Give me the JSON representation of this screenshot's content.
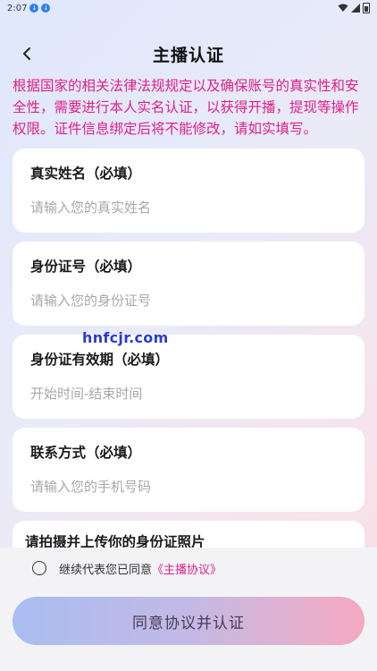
{
  "status_bar": {
    "time": "2:07"
  },
  "header": {
    "title": "主播认证"
  },
  "notice": "根据国家的相关法律法规规定以及确保账号的真实性和安全性，需要进行本人实名认证，以获得开播，提现等操作权限。证件信息绑定后将不能修改，请如实填写。",
  "form": {
    "name": {
      "label": "真实姓名（必填）",
      "placeholder": "请输入您的真实姓名"
    },
    "id_number": {
      "label": "身份证号（必填）",
      "placeholder": "请输入您的身份证号"
    },
    "id_validity": {
      "label": "身份证有效期（必填）",
      "placeholder": "开始时间-结束时间"
    },
    "contact": {
      "label": "联系方式（必填）",
      "placeholder": "请输入您的手机号码"
    },
    "upload": {
      "title": "请拍摄并上传你的身份证照片"
    }
  },
  "watermark": "hnfcjr.com",
  "agreement": {
    "prefix": "继续代表您已同意",
    "link": "《主播协议》"
  },
  "submit": {
    "label": "同意协议并认证"
  }
}
